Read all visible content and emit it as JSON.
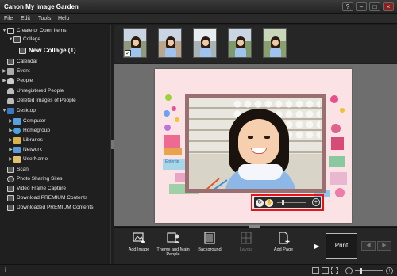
{
  "window": {
    "title": "Canon My Image Garden",
    "help_btn": "?",
    "min_btn": "–",
    "max_btn": "□",
    "close_btn": "×"
  },
  "menu": [
    "File",
    "Edit",
    "Tools",
    "Help"
  ],
  "sidebar": {
    "items": [
      {
        "label": "Create or Open Items",
        "arrow": "▼"
      },
      {
        "label": "Collage",
        "arrow": "▼"
      },
      {
        "label": "New Collage (1)",
        "arrow": ""
      },
      {
        "label": "Calendar",
        "arrow": ""
      },
      {
        "label": "Event",
        "arrow": "▶"
      },
      {
        "label": "People",
        "arrow": "▶"
      },
      {
        "label": "Unregistered People",
        "arrow": ""
      },
      {
        "label": "Deleted Images of People",
        "arrow": ""
      },
      {
        "label": "Desktop",
        "arrow": "▼"
      },
      {
        "label": "Computer",
        "arrow": "▶"
      },
      {
        "label": "Homegroup",
        "arrow": "▶"
      },
      {
        "label": "Libraries",
        "arrow": "▶"
      },
      {
        "label": "Network",
        "arrow": "▶"
      },
      {
        "label": "UserName",
        "arrow": "▶"
      },
      {
        "label": "Scan",
        "arrow": ""
      },
      {
        "label": "Photo Sharing Sites",
        "arrow": ""
      },
      {
        "label": "Video Frame Capture",
        "arrow": ""
      },
      {
        "label": "Download PREMIUM Contents",
        "arrow": ""
      },
      {
        "label": "Downloaded PREMIUM Contents",
        "arrow": ""
      }
    ]
  },
  "thumbnails": {
    "count": 5,
    "first_checked": true,
    "check_mark": "✓"
  },
  "page_editor": {
    "image_tools": {
      "rotate_icon": "↻",
      "hand_icon": "✋",
      "zoom_in_icon": "+"
    },
    "deco_text": "Enter te"
  },
  "toolbar": {
    "add_image": "Add Image",
    "theme_people": "Theme and Main People",
    "background": "Background",
    "layout": "Layout",
    "add_page": "Add Page",
    "next_arrow": "▶",
    "print": "Print",
    "prev_page": "◀",
    "next_page": "▶"
  },
  "status": {
    "info": "i",
    "zoom_minus": "−",
    "zoom_plus": "+"
  }
}
